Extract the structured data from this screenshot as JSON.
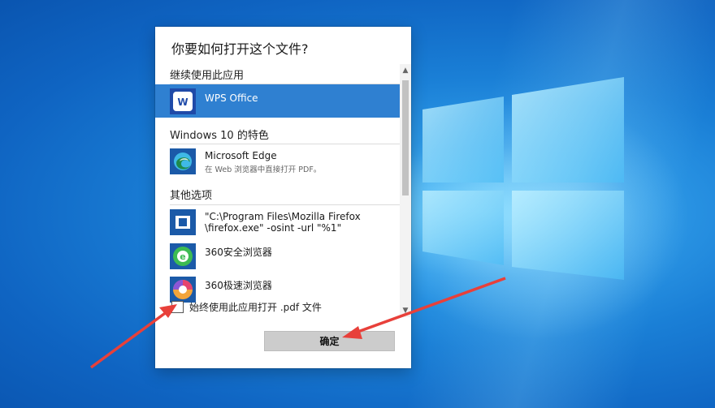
{
  "dialog": {
    "title": "你要如何打开这个文件?",
    "sections": {
      "continue": "继续使用此应用",
      "windows10": "Windows 10 的特色",
      "other": "其他选项"
    },
    "apps": [
      {
        "name": "WPS Office",
        "selected": true,
        "icon": "wps-office-icon"
      },
      {
        "name": "Microsoft Edge",
        "sub": "在 Web 浏览器中直接打开 PDF。",
        "icon": "microsoft-edge-icon"
      },
      {
        "name_line1": "\"C:\\Program Files\\Mozilla Firefox",
        "name_line2": "\\firefox.exe\" -osint -url \"%1\"",
        "icon": "generic-app-icon"
      },
      {
        "name": "360安全浏览器",
        "icon": "360-safe-browser-icon"
      },
      {
        "name": "360极速浏览器",
        "icon": "360-speed-browser-icon"
      }
    ],
    "always_use_label": "始终使用此应用打开 .pdf 文件",
    "always_use_checked": false,
    "ok_label": "确定"
  },
  "colors": {
    "selected": "#2f80d1",
    "annotation_arrow": "#e8403a",
    "desktop": "#1a7fd6"
  }
}
